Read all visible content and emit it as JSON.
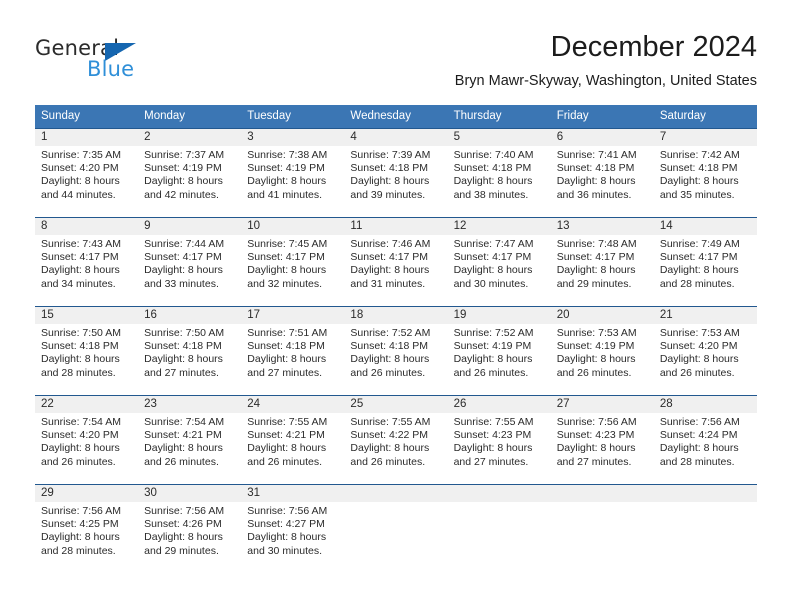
{
  "brand": {
    "name_part1": "General",
    "name_part2": "Blue",
    "triangle_icon": "blue-triangle-icon",
    "accent_color": "#1566b0",
    "blue_text_color": "#2f8fd8"
  },
  "header": {
    "month_title": "December 2024",
    "location": "Bryn Mawr-Skyway, Washington, United States"
  },
  "calendar": {
    "header_bg": "#3b76b4",
    "row_divider_color": "#22588f",
    "daynum_bg": "#f0f0f0",
    "columns": [
      "Sunday",
      "Monday",
      "Tuesday",
      "Wednesday",
      "Thursday",
      "Friday",
      "Saturday"
    ],
    "weeks": [
      [
        {
          "day": "1",
          "sunrise": "Sunrise: 7:35 AM",
          "sunset": "Sunset: 4:20 PM",
          "daylight1": "Daylight: 8 hours",
          "daylight2": "and 44 minutes."
        },
        {
          "day": "2",
          "sunrise": "Sunrise: 7:37 AM",
          "sunset": "Sunset: 4:19 PM",
          "daylight1": "Daylight: 8 hours",
          "daylight2": "and 42 minutes."
        },
        {
          "day": "3",
          "sunrise": "Sunrise: 7:38 AM",
          "sunset": "Sunset: 4:19 PM",
          "daylight1": "Daylight: 8 hours",
          "daylight2": "and 41 minutes."
        },
        {
          "day": "4",
          "sunrise": "Sunrise: 7:39 AM",
          "sunset": "Sunset: 4:18 PM",
          "daylight1": "Daylight: 8 hours",
          "daylight2": "and 39 minutes."
        },
        {
          "day": "5",
          "sunrise": "Sunrise: 7:40 AM",
          "sunset": "Sunset: 4:18 PM",
          "daylight1": "Daylight: 8 hours",
          "daylight2": "and 38 minutes."
        },
        {
          "day": "6",
          "sunrise": "Sunrise: 7:41 AM",
          "sunset": "Sunset: 4:18 PM",
          "daylight1": "Daylight: 8 hours",
          "daylight2": "and 36 minutes."
        },
        {
          "day": "7",
          "sunrise": "Sunrise: 7:42 AM",
          "sunset": "Sunset: 4:18 PM",
          "daylight1": "Daylight: 8 hours",
          "daylight2": "and 35 minutes."
        }
      ],
      [
        {
          "day": "8",
          "sunrise": "Sunrise: 7:43 AM",
          "sunset": "Sunset: 4:17 PM",
          "daylight1": "Daylight: 8 hours",
          "daylight2": "and 34 minutes."
        },
        {
          "day": "9",
          "sunrise": "Sunrise: 7:44 AM",
          "sunset": "Sunset: 4:17 PM",
          "daylight1": "Daylight: 8 hours",
          "daylight2": "and 33 minutes."
        },
        {
          "day": "10",
          "sunrise": "Sunrise: 7:45 AM",
          "sunset": "Sunset: 4:17 PM",
          "daylight1": "Daylight: 8 hours",
          "daylight2": "and 32 minutes."
        },
        {
          "day": "11",
          "sunrise": "Sunrise: 7:46 AM",
          "sunset": "Sunset: 4:17 PM",
          "daylight1": "Daylight: 8 hours",
          "daylight2": "and 31 minutes."
        },
        {
          "day": "12",
          "sunrise": "Sunrise: 7:47 AM",
          "sunset": "Sunset: 4:17 PM",
          "daylight1": "Daylight: 8 hours",
          "daylight2": "and 30 minutes."
        },
        {
          "day": "13",
          "sunrise": "Sunrise: 7:48 AM",
          "sunset": "Sunset: 4:17 PM",
          "daylight1": "Daylight: 8 hours",
          "daylight2": "and 29 minutes."
        },
        {
          "day": "14",
          "sunrise": "Sunrise: 7:49 AM",
          "sunset": "Sunset: 4:17 PM",
          "daylight1": "Daylight: 8 hours",
          "daylight2": "and 28 minutes."
        }
      ],
      [
        {
          "day": "15",
          "sunrise": "Sunrise: 7:50 AM",
          "sunset": "Sunset: 4:18 PM",
          "daylight1": "Daylight: 8 hours",
          "daylight2": "and 28 minutes."
        },
        {
          "day": "16",
          "sunrise": "Sunrise: 7:50 AM",
          "sunset": "Sunset: 4:18 PM",
          "daylight1": "Daylight: 8 hours",
          "daylight2": "and 27 minutes."
        },
        {
          "day": "17",
          "sunrise": "Sunrise: 7:51 AM",
          "sunset": "Sunset: 4:18 PM",
          "daylight1": "Daylight: 8 hours",
          "daylight2": "and 27 minutes."
        },
        {
          "day": "18",
          "sunrise": "Sunrise: 7:52 AM",
          "sunset": "Sunset: 4:18 PM",
          "daylight1": "Daylight: 8 hours",
          "daylight2": "and 26 minutes."
        },
        {
          "day": "19",
          "sunrise": "Sunrise: 7:52 AM",
          "sunset": "Sunset: 4:19 PM",
          "daylight1": "Daylight: 8 hours",
          "daylight2": "and 26 minutes."
        },
        {
          "day": "20",
          "sunrise": "Sunrise: 7:53 AM",
          "sunset": "Sunset: 4:19 PM",
          "daylight1": "Daylight: 8 hours",
          "daylight2": "and 26 minutes."
        },
        {
          "day": "21",
          "sunrise": "Sunrise: 7:53 AM",
          "sunset": "Sunset: 4:20 PM",
          "daylight1": "Daylight: 8 hours",
          "daylight2": "and 26 minutes."
        }
      ],
      [
        {
          "day": "22",
          "sunrise": "Sunrise: 7:54 AM",
          "sunset": "Sunset: 4:20 PM",
          "daylight1": "Daylight: 8 hours",
          "daylight2": "and 26 minutes."
        },
        {
          "day": "23",
          "sunrise": "Sunrise: 7:54 AM",
          "sunset": "Sunset: 4:21 PM",
          "daylight1": "Daylight: 8 hours",
          "daylight2": "and 26 minutes."
        },
        {
          "day": "24",
          "sunrise": "Sunrise: 7:55 AM",
          "sunset": "Sunset: 4:21 PM",
          "daylight1": "Daylight: 8 hours",
          "daylight2": "and 26 minutes."
        },
        {
          "day": "25",
          "sunrise": "Sunrise: 7:55 AM",
          "sunset": "Sunset: 4:22 PM",
          "daylight1": "Daylight: 8 hours",
          "daylight2": "and 26 minutes."
        },
        {
          "day": "26",
          "sunrise": "Sunrise: 7:55 AM",
          "sunset": "Sunset: 4:23 PM",
          "daylight1": "Daylight: 8 hours",
          "daylight2": "and 27 minutes."
        },
        {
          "day": "27",
          "sunrise": "Sunrise: 7:56 AM",
          "sunset": "Sunset: 4:23 PM",
          "daylight1": "Daylight: 8 hours",
          "daylight2": "and 27 minutes."
        },
        {
          "day": "28",
          "sunrise": "Sunrise: 7:56 AM",
          "sunset": "Sunset: 4:24 PM",
          "daylight1": "Daylight: 8 hours",
          "daylight2": "and 28 minutes."
        }
      ],
      [
        {
          "day": "29",
          "sunrise": "Sunrise: 7:56 AM",
          "sunset": "Sunset: 4:25 PM",
          "daylight1": "Daylight: 8 hours",
          "daylight2": "and 28 minutes."
        },
        {
          "day": "30",
          "sunrise": "Sunrise: 7:56 AM",
          "sunset": "Sunset: 4:26 PM",
          "daylight1": "Daylight: 8 hours",
          "daylight2": "and 29 minutes."
        },
        {
          "day": "31",
          "sunrise": "Sunrise: 7:56 AM",
          "sunset": "Sunset: 4:27 PM",
          "daylight1": "Daylight: 8 hours",
          "daylight2": "and 30 minutes."
        },
        {
          "day": "",
          "sunrise": "",
          "sunset": "",
          "daylight1": "",
          "daylight2": ""
        },
        {
          "day": "",
          "sunrise": "",
          "sunset": "",
          "daylight1": "",
          "daylight2": ""
        },
        {
          "day": "",
          "sunrise": "",
          "sunset": "",
          "daylight1": "",
          "daylight2": ""
        },
        {
          "day": "",
          "sunrise": "",
          "sunset": "",
          "daylight1": "",
          "daylight2": ""
        }
      ]
    ]
  }
}
